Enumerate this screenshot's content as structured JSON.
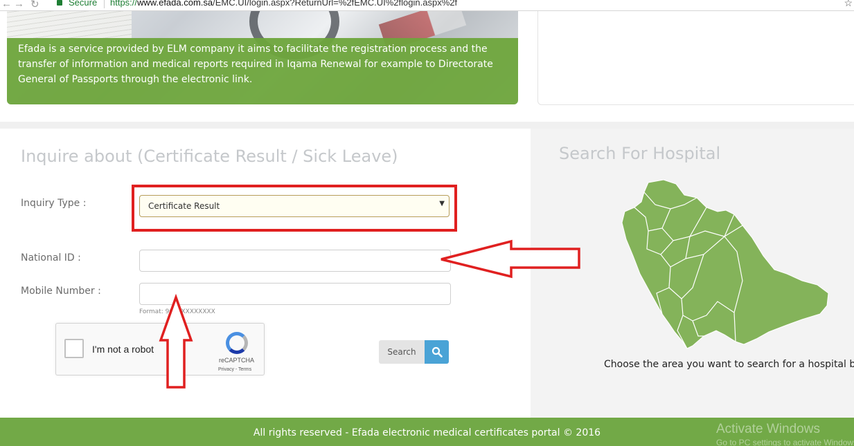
{
  "browser": {
    "back_icon": "back-arrow-icon",
    "forward_icon": "forward-arrow-icon",
    "reload_icon": "reload-icon",
    "secure_label": "Secure",
    "url_scheme": "https://",
    "url_host": "www.efada.com.sa",
    "url_path": "/EMC.UI/login.aspx?ReturnUrl=%2fEMC.UI%2flogin.aspx%2f",
    "star_icon": "bookmark-star-icon"
  },
  "banner": {
    "description": "Efada is a service provided by ELM company it aims to facilitate the registration process and the transfer of information and medical reports required in Iqama Renewal for example to Directorate General of Passports through the electronic link."
  },
  "inquiry": {
    "title": "Inquire about (Certificate Result / Sick Leave)",
    "inquiry_type_label": "Inquiry Type :",
    "inquiry_type_value": "Certificate Result",
    "national_id_label": "National ID :",
    "national_id_value": "",
    "mobile_label": "Mobile Number :",
    "mobile_value": "",
    "mobile_hint": "Format: 9665XXXXXXXX",
    "captcha_label": "I'm not a robot",
    "captcha_brand": "reCAPTCHA",
    "captcha_terms": "Privacy - Terms",
    "search_label": "Search"
  },
  "hospital": {
    "title": "Search For Hospital",
    "caption": "Choose the area you want to search for a hospital by"
  },
  "footer": {
    "copyright": "All rights reserved - Efada electronic medical certificates portal © 2016",
    "watermark_title": "Activate Windows",
    "watermark_sub": "Go to PC settings to activate Windows."
  },
  "colors": {
    "brand_green": "#72a947",
    "map_green": "#84b35a",
    "annotation_red": "#e02020",
    "search_blue": "#4aa3d6"
  }
}
